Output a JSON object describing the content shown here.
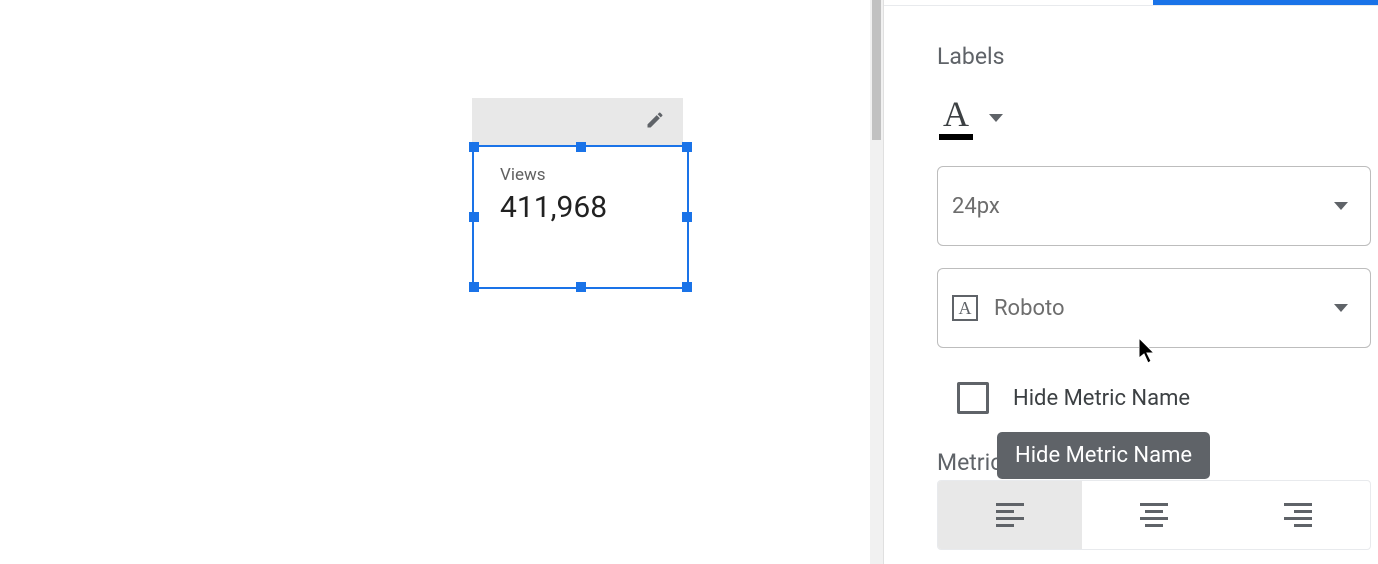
{
  "widget": {
    "metric_name": "Views",
    "metric_value": "411,968"
  },
  "sidebar": {
    "section_title": "Labels",
    "font_size": "24px",
    "font_family": "Roboto",
    "hide_metric_name_label": "Hide Metric Name",
    "tooltip": "Hide Metric Name",
    "metric_partial": "Metric"
  }
}
